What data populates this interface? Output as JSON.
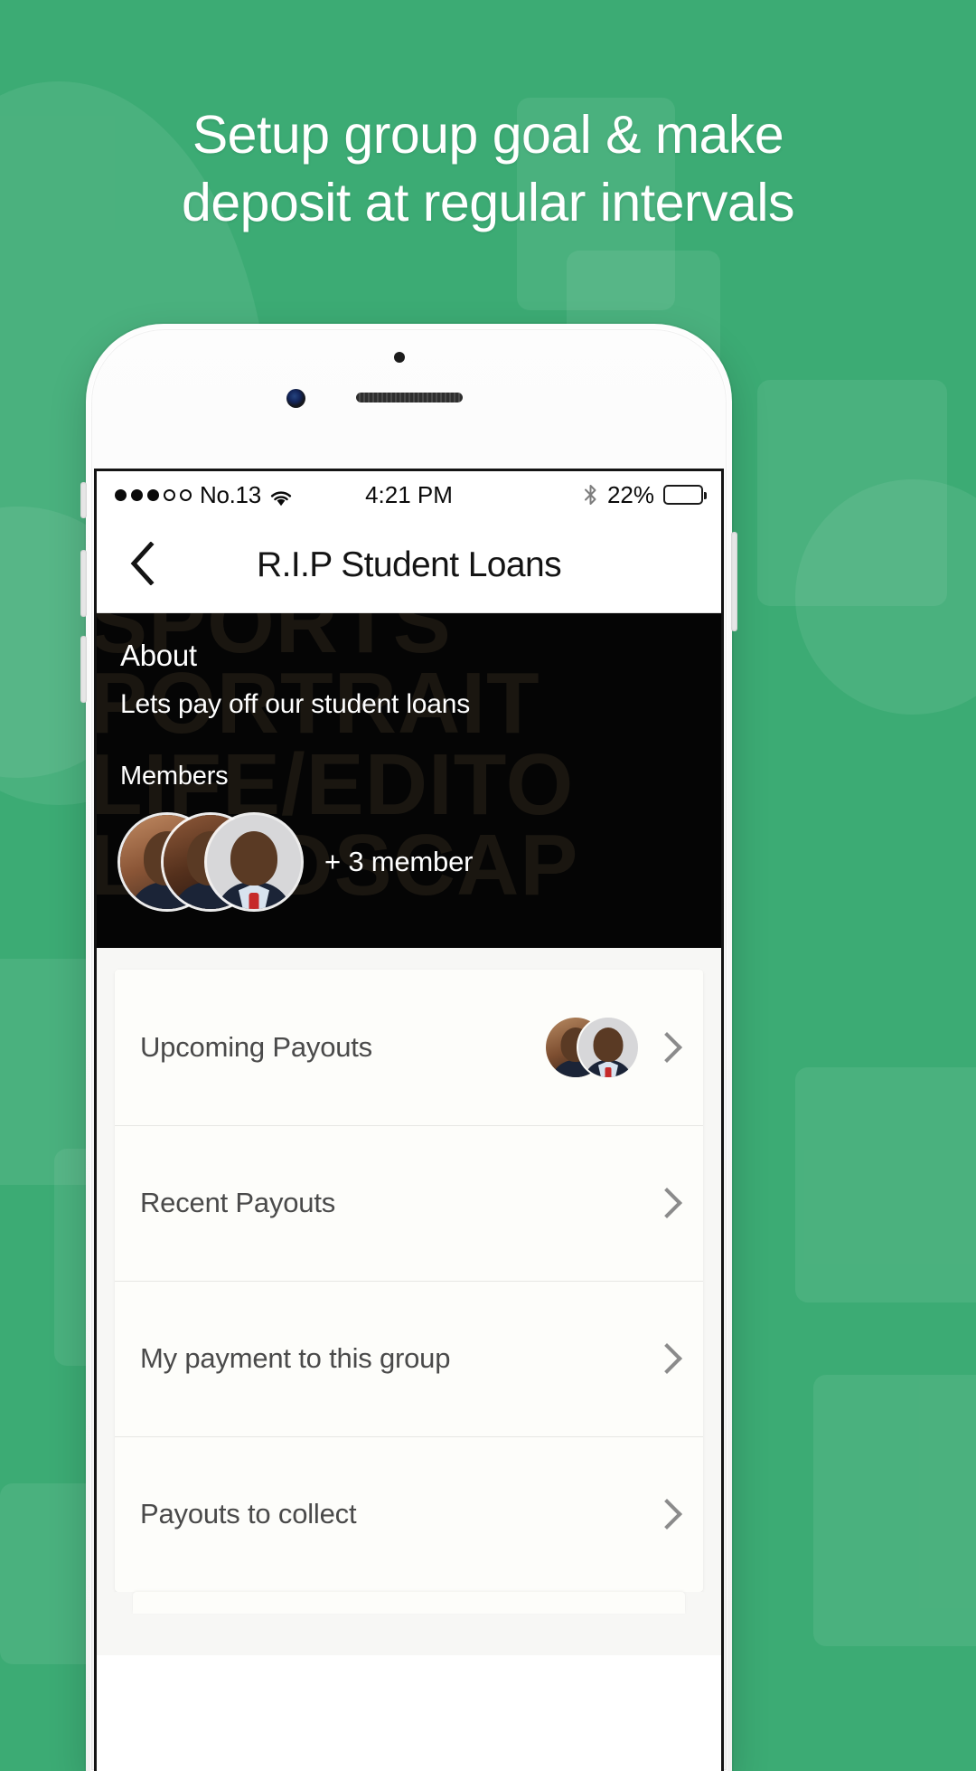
{
  "promo": {
    "headline_line1": "Setup group goal & make",
    "headline_line2": "deposit at regular intervals",
    "background_color": "#3cab74",
    "headline_color": "#ffffff"
  },
  "phone": {
    "status_bar": {
      "signal_dots_filled": 3,
      "signal_dots_total": 5,
      "carrier": "No.13",
      "wifi_icon": "wifi-icon",
      "time": "4:21 PM",
      "bluetooth_icon": "bluetooth-icon",
      "battery_percent_label": "22%",
      "battery_level": 22
    },
    "nav": {
      "back_icon": "chevron-left-icon",
      "title": "R.I.P Student Loans"
    },
    "hero": {
      "watermark_text": "SPORTS\nPORTRAIT\nLIFE/EDITO\nLANDSCAP",
      "about_heading": "About",
      "about_text": "Lets pay off our student loans",
      "members_heading": "Members",
      "members_extra_label": "+ 3 member",
      "avatar_count": 3
    },
    "list": {
      "rows": [
        {
          "label": "Upcoming Payouts",
          "has_avatars": true,
          "avatar_count": 2,
          "chevron_icon": "chevron-right-icon"
        },
        {
          "label": "Recent Payouts",
          "has_avatars": false,
          "avatar_count": 0,
          "chevron_icon": "chevron-right-icon"
        },
        {
          "label": "My payment to this group",
          "has_avatars": false,
          "avatar_count": 0,
          "chevron_icon": "chevron-right-icon"
        },
        {
          "label": "Payouts to collect",
          "has_avatars": false,
          "avatar_count": 0,
          "chevron_icon": "chevron-right-icon"
        }
      ]
    }
  }
}
